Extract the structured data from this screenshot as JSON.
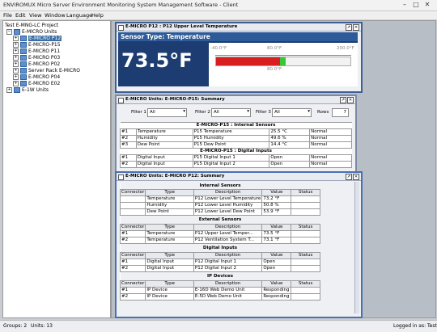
{
  "app": {
    "title": "ENVIROMUX Micro Server Environment Monitoring System Management Software - Client",
    "menu": [
      "File",
      "Edit",
      "View",
      "Window",
      "Language",
      "Help"
    ]
  },
  "tree": {
    "root": "Test E-MNG-LC Project",
    "group": "E-MICRO Units",
    "items": [
      "E-MICRO P12",
      "E-MICRO-P15",
      "E-MICRO P11",
      "E-MICRO P03",
      "E-MICRO P02",
      "Server Rack E-MICRO",
      "E-MICRO P04",
      "E-MICRO E02"
    ],
    "other": "E-1W Units"
  },
  "sensor_window": {
    "title": "E-MICRO P12 : P12 Upper Level Temperature",
    "sensor_type": "Sensor Type: Temperature",
    "reading": "73.5°F",
    "scale_min": "-40.0°F",
    "scale_mid": "80.0°F",
    "scale_max": "200.0°F",
    "threshold_label": "80.0°F",
    "value_fraction": 0.473
  },
  "p15_window": {
    "title": "E-MICRO Units: E-MICRO-P15: Summary",
    "filter1_label": "Filter 1",
    "filter2_label": "Filter 2",
    "filter3_label": "Filter 3",
    "filter_value": "All",
    "rows_label": "Rows",
    "rows_value": "7",
    "section_internal": "E-MICRO-P15 : Internal Sensors",
    "internal_rows": [
      [
        "#1",
        "Temperature",
        "P15 Temperature",
        "25.5 °C",
        "Normal"
      ],
      [
        "#2",
        "Humidity",
        "P15 Humidity",
        "49.6 %",
        "Normal"
      ],
      [
        "#3",
        "Dew Point",
        "P15 Dew Point",
        "14.4 °C",
        "Normal"
      ]
    ],
    "section_digital": "E-MICRO-P15 : Digital Inputs",
    "digital_rows": [
      [
        "#1",
        "Digital Input",
        "P15 Digital Input  1",
        "Open",
        "Normal"
      ],
      [
        "#2",
        "Digital Input",
        "P15 Digital Input  2",
        "Open",
        "Normal"
      ]
    ]
  },
  "p12_window": {
    "title": "E-MICRO Units: E-MICRO P12: Summary",
    "columns": [
      "Connector",
      "Type",
      "Description",
      "Value",
      "Status"
    ],
    "section_internal": "Internal Sensors",
    "internal_rows": [
      [
        "",
        "Temperature",
        "P12 Lower Level Temperature",
        "73.2 °F",
        ""
      ],
      [
        "",
        "Humidity",
        "P12 Lower Level Humidity",
        "50.8 %",
        ""
      ],
      [
        "",
        "Dew Point",
        "P12 Lower Level Dew Point",
        "53.9 °F",
        ""
      ]
    ],
    "section_external": "External Sensors",
    "external_rows": [
      [
        "#1",
        "Temperature",
        "P12 Upper Level Temper...",
        "73.5 °F",
        ""
      ],
      [
        "#2",
        "Temperature",
        "P12 Ventilation System T...",
        "73.1 °F",
        ""
      ]
    ],
    "section_digital": "Digital Inputs",
    "digital_rows": [
      [
        "#1",
        "Digital Input",
        "P12 Digital Input 1",
        "Open",
        ""
      ],
      [
        "#2",
        "Digital Input",
        "P12 Digital Input  2",
        "Open",
        ""
      ]
    ],
    "section_ip": "IP Devices",
    "ip_rows": [
      [
        "#1",
        "IP Device",
        "E-16D Web Demo Unit",
        "Responding",
        ""
      ],
      [
        "#2",
        "IP Device",
        "E-5D Web Demo Unit",
        "Responding",
        ""
      ]
    ]
  },
  "status": {
    "groups": "Groups: 2",
    "units": "Units: 13",
    "login": "Logged in as: Test"
  }
}
